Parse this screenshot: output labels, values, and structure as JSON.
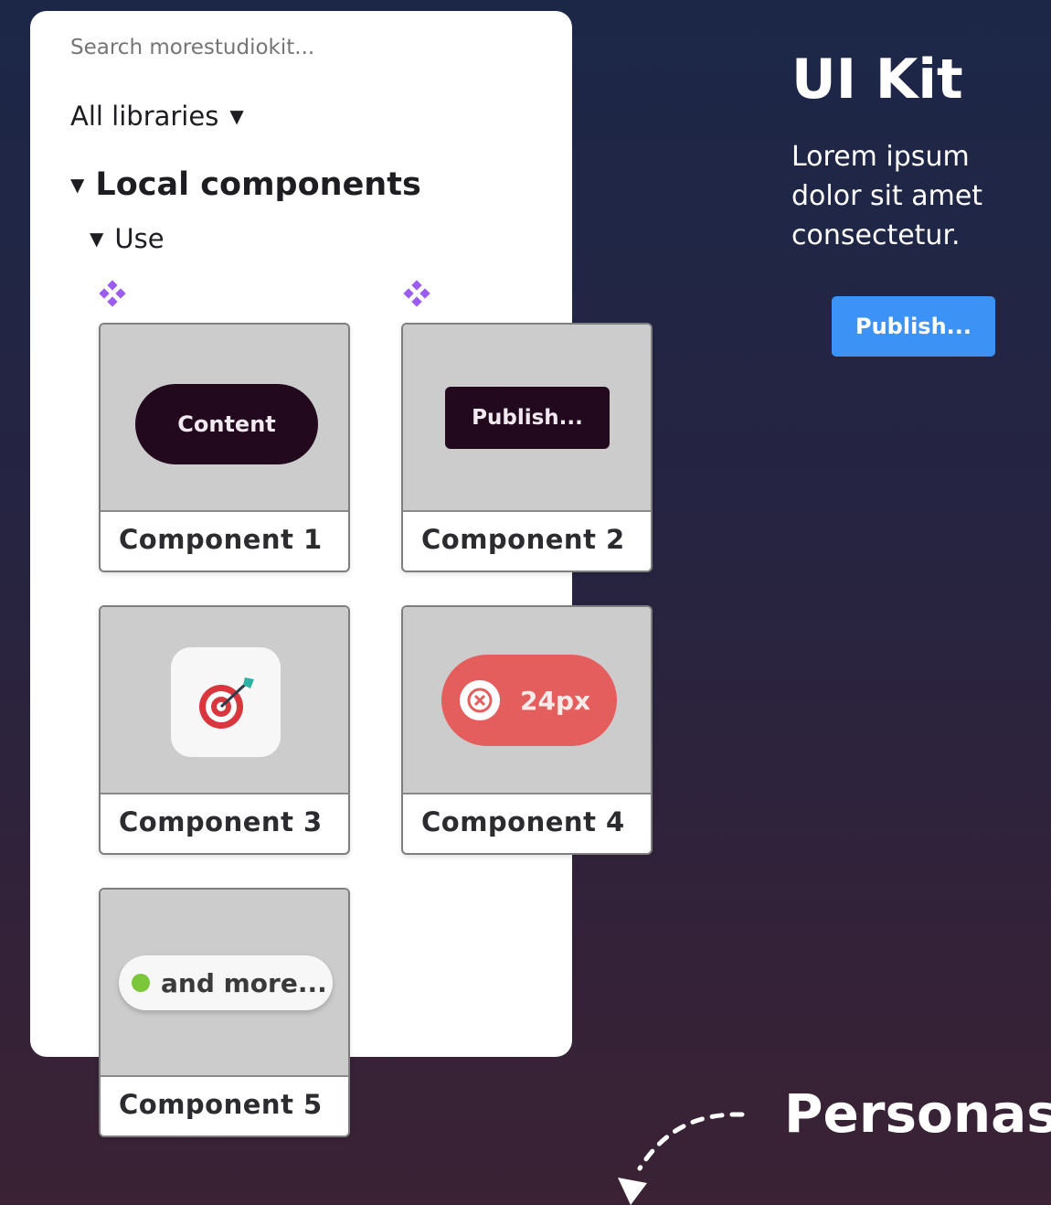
{
  "panel": {
    "search_placeholder": "Search morestudiokit...",
    "libraries_label": "All libraries",
    "libraries_icon": "caret-down-icon",
    "section_title": "Local components",
    "subsection_title": "Use",
    "component_icon": "component-diamond-icon",
    "accent_color": "#9b5cf0"
  },
  "components": [
    {
      "caption": "Component 1",
      "preview_label": "Content"
    },
    {
      "caption": "Component 2",
      "preview_label": "Publish..."
    },
    {
      "caption": "Component 3",
      "preview_icon": "target-dart-icon"
    },
    {
      "caption": "Component 4",
      "preview_label": "24px",
      "preview_icon": "close-circle-icon",
      "color": "#e55e5e"
    },
    {
      "caption": "Component 5",
      "preview_label": "and more..."
    }
  ],
  "sidebar": {
    "title": "UI Kit",
    "description": "Lorem ipsum dolor sit amet consectetur.",
    "publish_label": "Publish...",
    "publish_color": "#3d92f5"
  },
  "footer": {
    "personas_label": "Personas",
    "arrow_icon": "curved-dashed-arrow-icon"
  }
}
